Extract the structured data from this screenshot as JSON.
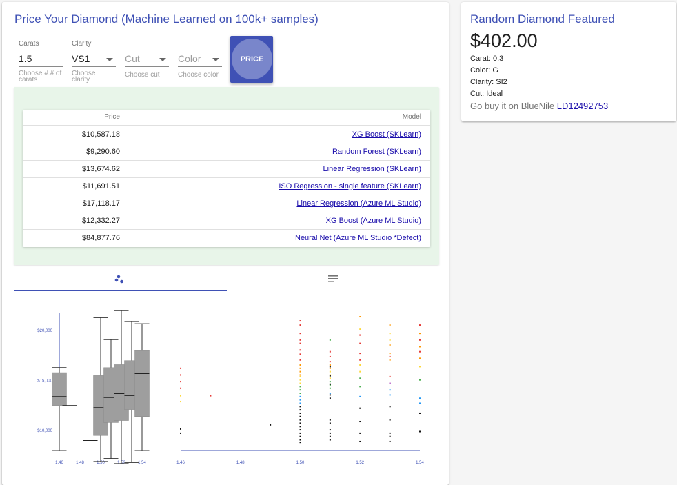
{
  "main": {
    "title": "Price Your Diamond (Machine Learned on 100k+ samples)",
    "form": {
      "carats": {
        "label": "Carats",
        "value": "1.5",
        "help": "Choose #.# of carats"
      },
      "clarity": {
        "label": "Clarity",
        "value": "VS1",
        "help": "Choose clarity"
      },
      "cut": {
        "placeholder": "Cut",
        "help": "Choose cut"
      },
      "color": {
        "placeholder": "Color",
        "help": "Choose color"
      },
      "price_button": "PRICE"
    },
    "results": {
      "headers": {
        "price": "Price",
        "model": "Model"
      },
      "rows": [
        {
          "price": "$10,587.18",
          "model": "XG Boost (SKLearn)"
        },
        {
          "price": "$9,290.60",
          "model": "Random Forest (SKLearn)"
        },
        {
          "price": "$13,674.62",
          "model": "Linear Regression (SKLearn)"
        },
        {
          "price": "$11,691.51",
          "model": "ISO Regression - single feature (SKLearn)"
        },
        {
          "price": "$17,118.17",
          "model": "Linear Regression (Azure ML Studio)"
        },
        {
          "price": "$12,332.27",
          "model": "XG Boost (Azure ML Studio)"
        },
        {
          "price": "$84,877.76",
          "model": "Neural Net (Azure ML Studio *Defect)"
        }
      ]
    },
    "tabs": [
      {
        "icon": "scatter-plot-icon",
        "active": true
      },
      {
        "icon": "list-icon",
        "active": false
      }
    ],
    "accent_color": "#3f51b5"
  },
  "featured": {
    "title": "Random Diamond Featured",
    "price": "$402.00",
    "carat": "Carat: 0.3",
    "color": "Color: G",
    "clarity": "Clarity: SI2",
    "cut": "Cut: Ideal",
    "buy_text": "Go buy it on BlueNile",
    "buy_link": "LD12492753"
  },
  "chart_data": [
    {
      "type": "box",
      "x_ticks": [
        "1.46",
        "1.48",
        "1.50",
        "1.52",
        "1.54"
      ],
      "y_ticks": [
        "$10,000",
        "$15,000",
        "$20,000"
      ],
      "xlim": [
        1.46,
        1.54
      ],
      "ylim": [
        8000,
        22500
      ],
      "boxes": [
        {
          "x": 1.46,
          "whisker_low": 8000,
          "q1": 12500,
          "median": 13400,
          "q3": 15800,
          "whisker_high": 16300
        },
        {
          "x": 1.47,
          "whisker_low": 12500,
          "q1": 12500,
          "median": 12500,
          "q3": 12500,
          "whisker_high": 12500
        },
        {
          "x": 1.49,
          "whisker_low": 9000,
          "q1": 9000,
          "median": 9000,
          "q3": 9000,
          "whisker_high": 9000
        },
        {
          "x": 1.5,
          "whisker_low": 6900,
          "q1": 9500,
          "median": 12300,
          "q3": 15500,
          "whisker_high": 21300
        },
        {
          "x": 1.51,
          "whisker_low": 7200,
          "q1": 10800,
          "median": 13300,
          "q3": 16300,
          "whisker_high": 19100
        },
        {
          "x": 1.52,
          "whisker_low": 6700,
          "q1": 11000,
          "median": 13700,
          "q3": 16600,
          "whisker_high": 22000
        },
        {
          "x": 1.53,
          "whisker_low": 6800,
          "q1": 12100,
          "median": 13500,
          "q3": 17000,
          "whisker_high": 20900
        },
        {
          "x": 1.54,
          "whisker_low": 8000,
          "q1": 11400,
          "median": 15700,
          "q3": 18000,
          "whisker_high": 20700
        }
      ]
    },
    {
      "type": "scatter",
      "x_ticks": [
        "1.46",
        "1.48",
        "1.50",
        "1.52",
        "1.54"
      ],
      "xlim": [
        1.46,
        1.54
      ],
      "ylim": [
        6500,
        22500
      ],
      "series": [
        {
          "x": 1.46,
          "color": "#e53935",
          "y": [
            15800,
            15000,
            14200,
            13400
          ]
        },
        {
          "x": 1.46,
          "color": "#fdd835",
          "y": [
            12500,
            11800
          ]
        },
        {
          "x": 1.46,
          "color": "#111111",
          "y": [
            8500,
            8000
          ]
        },
        {
          "x": 1.47,
          "color": "#e53935",
          "y": [
            12500
          ]
        },
        {
          "x": 1.49,
          "color": "#111111",
          "y": [
            9000
          ]
        },
        {
          "x": 1.5,
          "color": "#e53935",
          "y": [
            21500,
            21000,
            20000,
            19200,
            18800,
            18000,
            17500,
            16800
          ]
        },
        {
          "x": 1.5,
          "color": "#ff9800",
          "y": [
            16200,
            15800,
            15400,
            15000
          ]
        },
        {
          "x": 1.5,
          "color": "#fdd835",
          "y": [
            14800,
            14400,
            14000
          ]
        },
        {
          "x": 1.5,
          "color": "#4caf50",
          "y": [
            13600,
            13200,
            12800
          ]
        },
        {
          "x": 1.5,
          "color": "#2196f3",
          "y": [
            12400,
            12000,
            11600
          ]
        },
        {
          "x": 1.5,
          "color": "#111111",
          "y": [
            11200,
            10800,
            10400,
            10000,
            9600,
            9200,
            8800,
            8400,
            8000,
            7600,
            7200,
            6900
          ]
        },
        {
          "x": 1.51,
          "color": "#4caf50",
          "y": [
            19200
          ]
        },
        {
          "x": 1.51,
          "color": "#e53935",
          "y": [
            17800,
            17200,
            16600
          ]
        },
        {
          "x": 1.51,
          "color": "#ff9800",
          "y": [
            16200,
            15800
          ]
        },
        {
          "x": 1.51,
          "color": "#fdd835",
          "y": [
            15400,
            15000,
            14600
          ]
        },
        {
          "x": 1.51,
          "color": "#4caf50",
          "y": [
            14200,
            13800,
            13400
          ]
        },
        {
          "x": 1.51,
          "color": "#2196f3",
          "y": [
            12800
          ]
        },
        {
          "x": 1.51,
          "color": "#111111",
          "y": [
            16000,
            14900,
            13900,
            12600,
            12200,
            9600,
            9200,
            8400,
            8000,
            7600,
            7200
          ]
        },
        {
          "x": 1.52,
          "color": "#ff9800",
          "y": [
            22000
          ]
        },
        {
          "x": 1.52,
          "color": "#e53935",
          "y": [
            19800,
            18800,
            17600,
            16800
          ]
        },
        {
          "x": 1.52,
          "color": "#fdd835",
          "y": [
            20500,
            16200,
            15400
          ]
        },
        {
          "x": 1.52,
          "color": "#4caf50",
          "y": [
            14600,
            13600
          ]
        },
        {
          "x": 1.52,
          "color": "#2196f3",
          "y": [
            12400
          ]
        },
        {
          "x": 1.52,
          "color": "#111111",
          "y": [
            11000,
            9400,
            8000,
            7000
          ]
        },
        {
          "x": 1.53,
          "color": "#ff9800",
          "y": [
            21000,
            18600,
            17600,
            16800
          ]
        },
        {
          "x": 1.53,
          "color": "#fdd835",
          "y": [
            20000,
            19200
          ]
        },
        {
          "x": 1.53,
          "color": "#e53935",
          "y": [
            17200,
            14800
          ]
        },
        {
          "x": 1.53,
          "color": "#9c27b0",
          "y": [
            14000
          ]
        },
        {
          "x": 1.53,
          "color": "#2196f3",
          "y": [
            13200,
            12600
          ]
        },
        {
          "x": 1.53,
          "color": "#111111",
          "y": [
            11200,
            9600,
            8000,
            7600,
            7000
          ]
        },
        {
          "x": 1.54,
          "color": "#e53935",
          "y": [
            21000,
            19200,
            17800
          ]
        },
        {
          "x": 1.54,
          "color": "#ff9800",
          "y": [
            20000,
            18400,
            17000
          ]
        },
        {
          "x": 1.54,
          "color": "#fdd835",
          "y": [
            16000
          ]
        },
        {
          "x": 1.54,
          "color": "#4caf50",
          "y": [
            14400
          ]
        },
        {
          "x": 1.54,
          "color": "#2196f3",
          "y": [
            12200,
            11600
          ]
        },
        {
          "x": 1.54,
          "color": "#111111",
          "y": [
            10400,
            8200
          ]
        }
      ]
    }
  ]
}
